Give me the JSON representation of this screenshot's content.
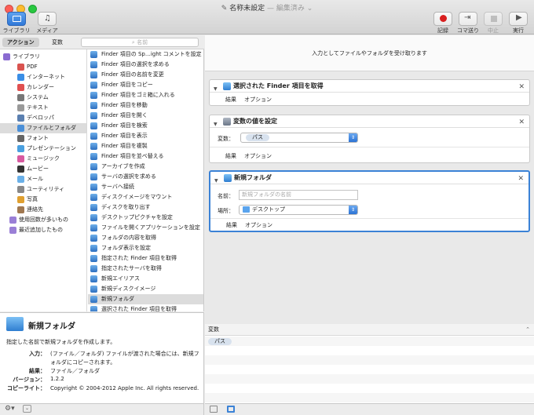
{
  "window": {
    "title": "名称未設定",
    "status": "— 編集済み ⌄"
  },
  "toolbar": {
    "library": "ライブラリ",
    "media": "メディア",
    "record": "記録",
    "step": "コマ送り",
    "stop": "中止",
    "run": "実行"
  },
  "tabs": {
    "actions": "アクション",
    "variables": "変数"
  },
  "search": {
    "placeholder": "名前"
  },
  "categories": [
    {
      "label": "ライブラリ",
      "color": "#8a6bd1"
    },
    {
      "label": "PDF",
      "color": "#d9534f"
    },
    {
      "label": "インターネット",
      "color": "#3a8ee6"
    },
    {
      "label": "カレンダー",
      "color": "#e05050"
    },
    {
      "label": "システム",
      "color": "#777777"
    },
    {
      "label": "テキスト",
      "color": "#999999"
    },
    {
      "label": "デベロッパ",
      "color": "#5a7fb0"
    },
    {
      "label": "ファイルとフォルダ",
      "color": "#4a8fd8"
    },
    {
      "label": "フォント",
      "color": "#666666"
    },
    {
      "label": "プレゼンテーション",
      "color": "#4aa0e0"
    },
    {
      "label": "ミュージック",
      "color": "#d85aa0"
    },
    {
      "label": "ムービー",
      "color": "#333333"
    },
    {
      "label": "メール",
      "color": "#6ab0e8"
    },
    {
      "label": "ユーティリティ",
      "color": "#888888"
    },
    {
      "label": "写真",
      "color": "#e0a030"
    },
    {
      "label": "連絡先",
      "color": "#a07850"
    },
    {
      "label": "使用回数が多いもの",
      "color": "#9a7fd6"
    },
    {
      "label": "最近追加したもの",
      "color": "#9a7fd6"
    }
  ],
  "actions": [
    "Finder 項目の Sp…ight コメントを設定",
    "Finder 項目の選択を求める",
    "Finder 項目の名前を変更",
    "Finder 項目をコピー",
    "Finder 項目をゴミ箱に入れる",
    "Finder 項目を移動",
    "Finder 項目を開く",
    "Finder 項目を検索",
    "Finder 項目を表示",
    "Finder 項目を複製",
    "Finder 項目を並べ替える",
    "アーカイブを作成",
    "サーバの選択を求める",
    "サーバへ接続",
    "ディスクイメージをマウント",
    "ディスクを取り出す",
    "デスクトップピクチャを設定",
    "ファイルを開くアプリケーションを設定",
    "フォルダの内容を取得",
    "フォルダ表示を設定",
    "指定された Finder 項目を取得",
    "指定されたサーバを取得",
    "新規エイリアス",
    "新規ディスクイメージ",
    "新規フォルダ",
    "選択された Finder 項目を取得"
  ],
  "description": {
    "title": "新規フォルダ",
    "summary": "指定した名前で新規フォルダを作成します。",
    "input_label": "入力：",
    "input": "(ファイル／フォルダ) ファイルが渡された場合には、新規フォルダにコピーされます。",
    "result_label": "結果：",
    "result": "ファイル／フォルダ",
    "version_label": "バージョン：",
    "version": "1.2.2",
    "copyright_label": "コピーライト：",
    "copyright": "Copyright © 2004-2012 Apple Inc.  All rights reserved."
  },
  "workflow": {
    "header": "入力としてファイルやフォルダを受け取ります",
    "result_label": "結果",
    "options_label": "オプション",
    "card1": {
      "title": "選択された Finder 項目を取得"
    },
    "card2": {
      "title": "変数の値を設定",
      "var_label": "変数：",
      "var_value": "パス"
    },
    "card3": {
      "title": "新規フォルダ",
      "name_label": "名前：",
      "name_placeholder": "新規フォルダの名前",
      "place_label": "場所：",
      "place_value": "デスクトップ"
    }
  },
  "variables": {
    "header": "変数",
    "items": [
      "パス"
    ]
  }
}
